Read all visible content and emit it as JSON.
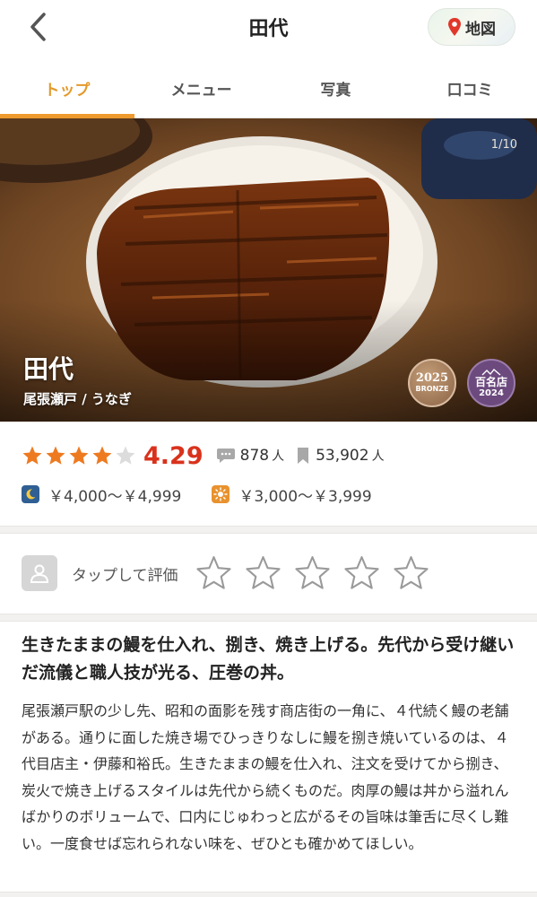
{
  "header": {
    "title": "田代",
    "map_label": "地図"
  },
  "tabs": [
    {
      "label": "トップ",
      "active": true
    },
    {
      "label": "メニュー",
      "active": false
    },
    {
      "label": "写真",
      "active": false
    },
    {
      "label": "口コミ",
      "active": false
    }
  ],
  "hero": {
    "photo_counter": "1/10",
    "name": "田代",
    "subtitle": "尾張瀬戸 / うなぎ",
    "badge_bronze": {
      "year": "2025",
      "text": "BRONZE"
    },
    "badge_hyakumeiten": {
      "text": "百名店",
      "year": "2024"
    }
  },
  "rating": {
    "stars_filled": 4,
    "stars_total": 5,
    "score": "4.29",
    "review_count": "878",
    "review_unit": "人",
    "saved_count": "53,902",
    "saved_unit": "人"
  },
  "price": {
    "dinner": "￥4,000～￥4,999",
    "lunch": "￥3,000～￥3,999"
  },
  "user_rating": {
    "label": "タップして評価",
    "star_count": 5
  },
  "description": {
    "title": "生きたままの鰻を仕入れ、捌き、焼き上げる。先代から受け継いだ流儀と職人技が光る、圧巻の丼。",
    "body": "尾張瀬戸駅の少し先、昭和の面影を残す商店街の一角に、４代続く鰻の老舗がある。通りに面した焼き場でひっきりなしに鰻を捌き焼いているのは、４代目店主・伊藤和裕氏。生きたままの鰻を仕入れ、注文を受けてから捌き、炭火で焼き上げるスタイルは先代から続くものだ。肉厚の鰻は丼から溢れんばかりのボリュームで、口内にじゅわっと広がるその旨味は筆舌に尽くし難い。一度食せば忘れられない味を、ぜひとも確かめてほしい。"
  },
  "colors": {
    "accent": "#ee9a2e",
    "star": "#ee7a20",
    "score": "#d9321c",
    "dinner_icon": "#2f5f93",
    "lunch_icon": "#e8922f"
  }
}
